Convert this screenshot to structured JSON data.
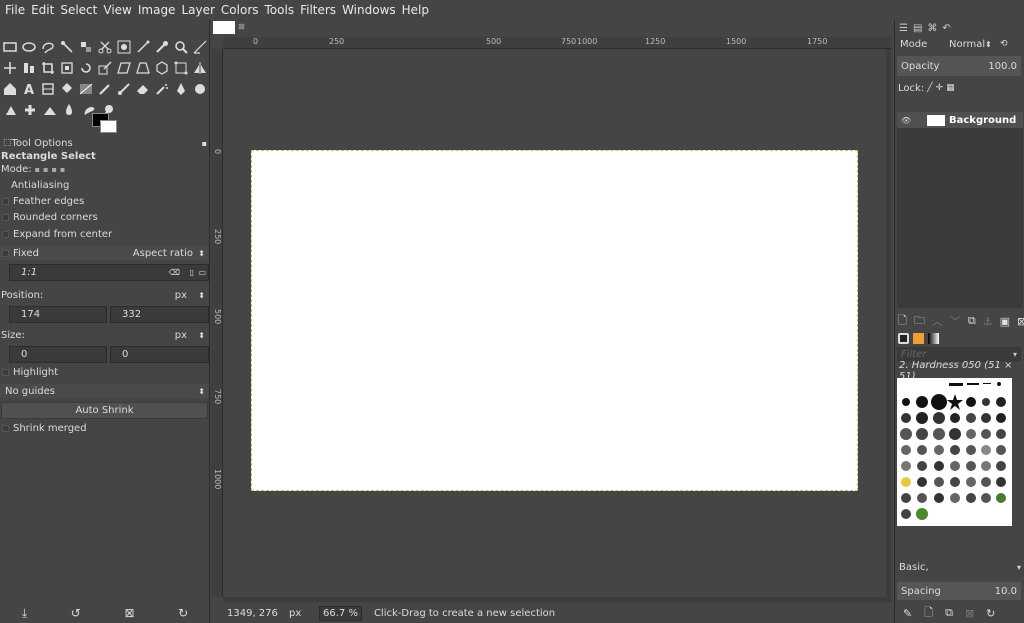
{
  "menubar": {
    "items": [
      "File",
      "Edit",
      "Select",
      "View",
      "Image",
      "Layer",
      "Colors",
      "Tools",
      "Filters",
      "Windows",
      "Help"
    ]
  },
  "toolbox": {
    "rows": [
      [
        "rect-select-icon",
        "ellipse-select-icon",
        "free-select-icon",
        "fuzzy-select-icon",
        "color-select-icon",
        "scissors-icon",
        "foreground-select-icon",
        "paths-icon",
        "color-picker-icon",
        "zoom-icon",
        "measure-icon"
      ],
      [
        "move-icon",
        "align-icon",
        "crop-icon",
        "unified-transform-icon",
        "rotate-icon",
        "scale-icon",
        "shear-icon",
        "perspective-icon",
        "3d-transform-icon",
        "handle-transform-icon",
        "flip-icon"
      ],
      [
        "cage-icon",
        "warp-icon",
        "text-icon",
        "bucket-fill-icon",
        "gradient-icon",
        "pencil-icon",
        "paintbrush-icon",
        "eraser-icon",
        "airbrush-icon",
        "ink-icon",
        "mypaint-icon"
      ],
      [
        "clone-icon",
        "heal-icon",
        "perspective-clone-icon",
        "blur-icon",
        "smudge-icon",
        "dodge-burn-icon"
      ]
    ],
    "colors": {
      "foreground": "#000000",
      "background": "#ffffff"
    }
  },
  "tool_options": {
    "title": "Tool Options",
    "tool_name": "Rectangle Select",
    "mode_label": "Mode:",
    "antialiasing": "Antialiasing",
    "feather_edges": "Feather edges",
    "rounded_corners": "Rounded corners",
    "expand_from_center": "Expand from center",
    "fixed_label": "Fixed",
    "fixed_option": "Aspect ratio",
    "ratio_value": "1:1",
    "position_label": "Position:",
    "position_unit": "px",
    "position_x": "174",
    "position_y": "332",
    "size_label": "Size:",
    "size_unit": "px",
    "size_w": "0",
    "size_h": "0",
    "highlight": "Highlight",
    "guides": "No guides",
    "auto_shrink": "Auto Shrink",
    "shrink_merged": "Shrink merged"
  },
  "canvas": {
    "ruler_labels": [
      "0",
      "250",
      "500",
      "750",
      "1000",
      "1250",
      "1500",
      "1750"
    ],
    "vruler_labels": [
      "0",
      "250",
      "500",
      "750",
      "1000"
    ]
  },
  "status": {
    "coords": "1349, 276",
    "unit": "px",
    "zoom": "66.7 %",
    "message": "Click-Drag to create a new selection"
  },
  "dock": {
    "mode_label": "Mode",
    "mode_value": "Normal",
    "opacity_label": "Opacity",
    "opacity_value": "100.0",
    "lock_label": "Lock:",
    "layer_name": "Background",
    "filter_placeholder": "Filter",
    "brush_name": "2. Hardness 050 (51 × 51)",
    "brush_set": "Basic,",
    "spacing_label": "Spacing",
    "spacing_value": "10.0"
  }
}
